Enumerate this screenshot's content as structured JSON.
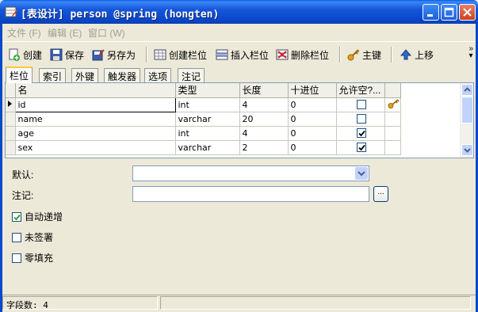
{
  "window": {
    "title": "[表设计] person @spring (hongten)"
  },
  "menu": [
    {
      "label": "文件 (F)"
    },
    {
      "label": "编辑 (E)"
    },
    {
      "label": "窗口 (W)"
    }
  ],
  "toolbar": {
    "new_label": "创建",
    "save_label": "保存",
    "save_as_label": "另存为",
    "create_field_label": "创建栏位",
    "insert_field_label": "插入栏位",
    "delete_field_label": "删除栏位",
    "primary_key_label": "主键",
    "move_up_label": "上移",
    "more_label": "»"
  },
  "tabs": [
    {
      "label": "栏位",
      "active": true
    },
    {
      "label": "索引",
      "active": false
    },
    {
      "label": "外键",
      "active": false
    },
    {
      "label": "触发器",
      "active": false
    },
    {
      "label": "选项",
      "active": false
    },
    {
      "label": "注记",
      "active": false
    }
  ],
  "grid": {
    "headers": [
      "名",
      "类型",
      "长度",
      "十进位",
      "允许空?..."
    ],
    "rows": [
      {
        "name": "id",
        "type": "int",
        "length": "4",
        "decimals": "0",
        "allow_null": false,
        "primary_key": true,
        "current": true
      },
      {
        "name": "name",
        "type": "varchar",
        "length": "20",
        "decimals": "0",
        "allow_null": false,
        "primary_key": false,
        "current": false
      },
      {
        "name": "age",
        "type": "int",
        "length": "4",
        "decimals": "0",
        "allow_null": true,
        "primary_key": false,
        "current": false
      },
      {
        "name": "sex",
        "type": "varchar",
        "length": "2",
        "decimals": "0",
        "allow_null": true,
        "primary_key": false,
        "current": false
      }
    ]
  },
  "form": {
    "default_label": "默认:",
    "default_value": "",
    "comment_label": "注记:",
    "comment_value": "",
    "ellipsis_label": "...",
    "auto_increment_label": "自动递增",
    "auto_increment_checked": true,
    "unsigned_label": "未签署",
    "unsigned_checked": false,
    "zerofill_label": "零填充",
    "zerofill_checked": false
  },
  "status": {
    "field_count": "字段数: 4"
  },
  "colors": {
    "titlebar": "#0A48CC",
    "window_bg": "#ECE9D8",
    "active_tab_accent": "#FFC83C",
    "key_icon": "#E0A020"
  }
}
